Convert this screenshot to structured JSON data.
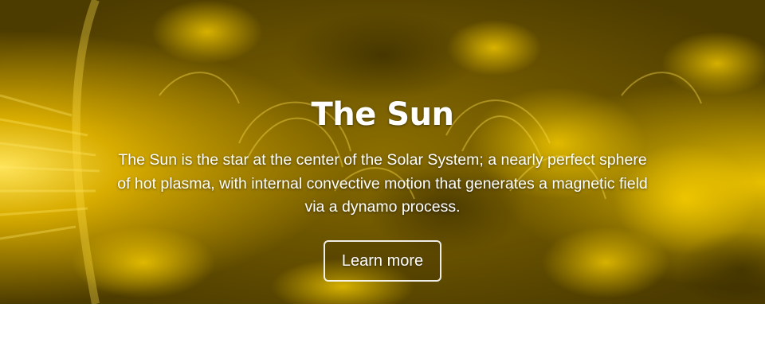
{
  "hero": {
    "title": "The Sun",
    "description": "The Sun is the star at the center of the Solar System; a nearly perfect sphere of hot plasma, with internal convective motion that generates a magnetic field via a dynamo process.",
    "button_label": "Learn more"
  },
  "colors": {
    "hero_overlay": "#6b5400",
    "sun_glow": "#f2c400",
    "text": "#ffffff",
    "page_background": "#ffffff"
  }
}
